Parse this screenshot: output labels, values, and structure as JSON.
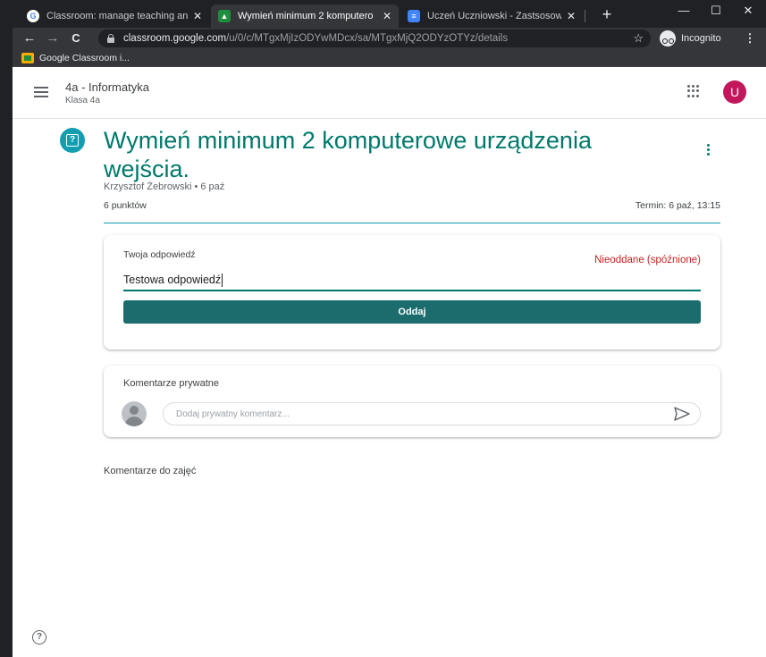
{
  "browser": {
    "tabs": [
      {
        "title": "Classroom: manage teaching and",
        "close": "✕",
        "icon": "google-icon"
      },
      {
        "title": "Wymień minimum 2 komputero",
        "close": "✕",
        "icon": "classroom-icon"
      },
      {
        "title": "Uczeń Uczniowski - Zastsosowa",
        "close": "✕",
        "icon": "docs-icon"
      }
    ],
    "new_tab": "+",
    "window_controls": {
      "minimize": "—",
      "maximize": "☐",
      "close": "✕"
    },
    "nav": {
      "back": "←",
      "forward": "→",
      "reload": "C"
    },
    "url_host": "classroom.google.com",
    "url_path": "/u/0/c/MTgxMjIzODYwMDcx/sa/MTgxMjQ2ODYzOTYz/details",
    "bookmark_star": "☆",
    "incognito_label": "Incognito",
    "menu": "⋮",
    "bookmarks": [
      {
        "label": "Google Classroom i..."
      }
    ],
    "colors": {
      "frame": "#202124",
      "toolbar": "#35363a"
    }
  },
  "app": {
    "class_title": "4a - Informatyka",
    "class_subtitle": "Klasa 4a",
    "avatar_letter": "U",
    "colors": {
      "accent": "#00796b",
      "avatar": "#c2185b",
      "late": "#c5221f"
    }
  },
  "assignment": {
    "title": "Wymień minimum 2 komputerowe urządzenia wejścia.",
    "author_date": "Krzysztof Żebrowski • 6 paź",
    "points": "6 punktów",
    "due": "Termin: 6 paź, 13:15",
    "icon_glyph": "?"
  },
  "answer_card": {
    "label": "Twoja odpowiedź",
    "status": "Nieoddane (spóźnione)",
    "answer_text": "Testowa odpowiedź",
    "submit_label": "Oddaj"
  },
  "private_comments": {
    "label": "Komentarze prywatne",
    "placeholder": "Dodaj prywatny komentarz..."
  },
  "class_comments": {
    "label": "Komentarze do zajęć"
  },
  "help_glyph": "?"
}
